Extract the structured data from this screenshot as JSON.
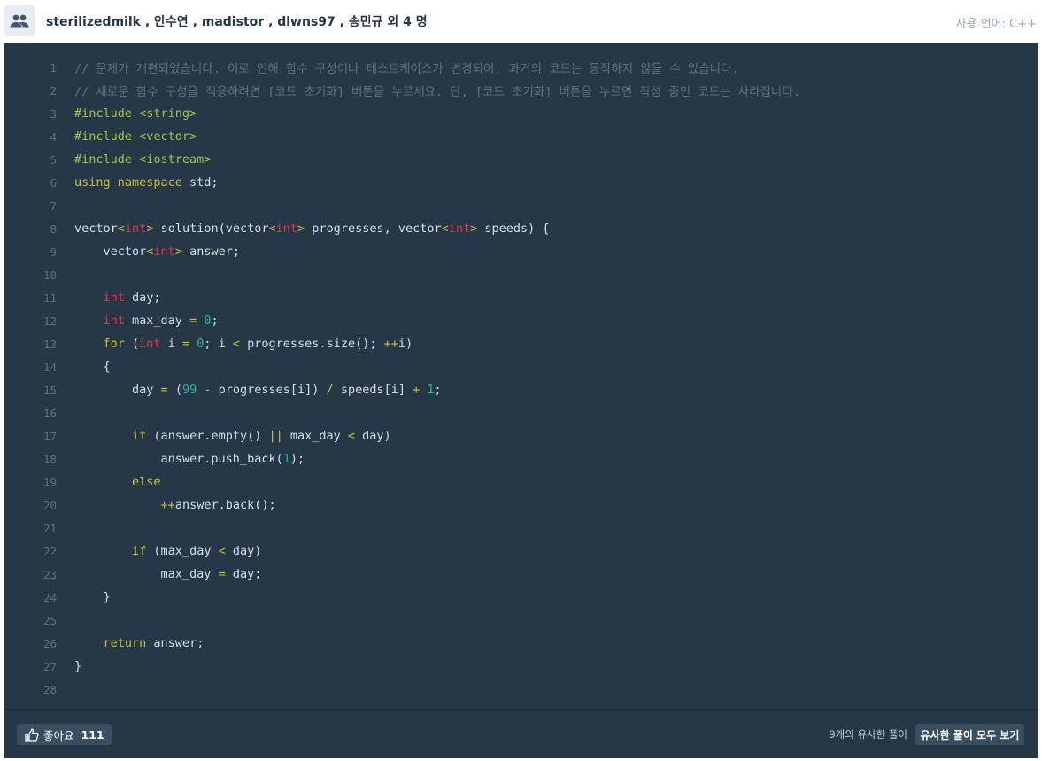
{
  "header": {
    "authors": "sterilizedmilk , 안수연 , madistor , dlwns97 , 송민규 외 4 명",
    "language": "사용 언어: C++",
    "icon": "people-icon"
  },
  "code": {
    "lines": [
      [
        [
          "c-comment",
          "// 문제가 개편되었습니다. 이로 인해 함수 구성이나 테스트케이스가 변경되어, 과거의 코드는 동작하지 않을 수 있습니다."
        ]
      ],
      [
        [
          "c-comment",
          "// 새로운 함수 구성을 적용하려면 [코드 초기화] 버튼을 누르세요. 단, [코드 초기화] 버튼을 누르면 작성 중인 코드는 사라집니다."
        ]
      ],
      [
        [
          "c-pre",
          "#include <string>"
        ]
      ],
      [
        [
          "c-pre",
          "#include <vector>"
        ]
      ],
      [
        [
          "c-pre",
          "#include <iostream>"
        ]
      ],
      [
        [
          "c-kw",
          "using namespace"
        ],
        [
          "c-plain",
          " std;"
        ]
      ],
      [],
      [
        [
          "c-plain",
          "vector"
        ],
        [
          "c-op",
          "<"
        ],
        [
          "c-type",
          "int"
        ],
        [
          "c-op",
          ">"
        ],
        [
          "c-plain",
          " solution(vector"
        ],
        [
          "c-op",
          "<"
        ],
        [
          "c-type",
          "int"
        ],
        [
          "c-op",
          ">"
        ],
        [
          "c-plain",
          " progresses, vector"
        ],
        [
          "c-op",
          "<"
        ],
        [
          "c-type",
          "int"
        ],
        [
          "c-op",
          ">"
        ],
        [
          "c-plain",
          " speeds) {"
        ]
      ],
      [
        [
          "c-plain",
          "    vector"
        ],
        [
          "c-op",
          "<"
        ],
        [
          "c-type",
          "int"
        ],
        [
          "c-op",
          ">"
        ],
        [
          "c-plain",
          " answer;"
        ]
      ],
      [],
      [
        [
          "c-plain",
          "    "
        ],
        [
          "c-type",
          "int"
        ],
        [
          "c-plain",
          " day;"
        ]
      ],
      [
        [
          "c-plain",
          "    "
        ],
        [
          "c-type",
          "int"
        ],
        [
          "c-plain",
          " max_day "
        ],
        [
          "c-op",
          "="
        ],
        [
          "c-plain",
          " "
        ],
        [
          "c-num",
          "0"
        ],
        [
          "c-plain",
          ";"
        ]
      ],
      [
        [
          "c-plain",
          "    "
        ],
        [
          "c-kw",
          "for"
        ],
        [
          "c-plain",
          " ("
        ],
        [
          "c-type",
          "int"
        ],
        [
          "c-plain",
          " i "
        ],
        [
          "c-op",
          "="
        ],
        [
          "c-plain",
          " "
        ],
        [
          "c-num",
          "0"
        ],
        [
          "c-plain",
          "; i "
        ],
        [
          "c-op",
          "<"
        ],
        [
          "c-plain",
          " progresses.size(); "
        ],
        [
          "c-op",
          "++"
        ],
        [
          "c-plain",
          "i)"
        ]
      ],
      [
        [
          "c-plain",
          "    {"
        ]
      ],
      [
        [
          "c-plain",
          "        day "
        ],
        [
          "c-op",
          "="
        ],
        [
          "c-plain",
          " ("
        ],
        [
          "c-num",
          "99"
        ],
        [
          "c-plain",
          " "
        ],
        [
          "c-op",
          "-"
        ],
        [
          "c-plain",
          " progresses[i]) "
        ],
        [
          "c-op",
          "/"
        ],
        [
          "c-plain",
          " speeds[i] "
        ],
        [
          "c-op",
          "+"
        ],
        [
          "c-plain",
          " "
        ],
        [
          "c-num",
          "1"
        ],
        [
          "c-plain",
          ";"
        ]
      ],
      [],
      [
        [
          "c-plain",
          "        "
        ],
        [
          "c-kw",
          "if"
        ],
        [
          "c-plain",
          " (answer.empty() "
        ],
        [
          "c-op",
          "||"
        ],
        [
          "c-plain",
          " max_day "
        ],
        [
          "c-op",
          "<"
        ],
        [
          "c-plain",
          " day)"
        ]
      ],
      [
        [
          "c-plain",
          "            answer.push_back("
        ],
        [
          "c-num",
          "1"
        ],
        [
          "c-plain",
          ");"
        ]
      ],
      [
        [
          "c-plain",
          "        "
        ],
        [
          "c-kw",
          "else"
        ]
      ],
      [
        [
          "c-plain",
          "            "
        ],
        [
          "c-op",
          "++"
        ],
        [
          "c-plain",
          "answer.back();"
        ]
      ],
      [],
      [
        [
          "c-plain",
          "        "
        ],
        [
          "c-kw",
          "if"
        ],
        [
          "c-plain",
          " (max_day "
        ],
        [
          "c-op",
          "<"
        ],
        [
          "c-plain",
          " day)"
        ]
      ],
      [
        [
          "c-plain",
          "            max_day "
        ],
        [
          "c-op",
          "="
        ],
        [
          "c-plain",
          " day;"
        ]
      ],
      [
        [
          "c-plain",
          "    }"
        ]
      ],
      [],
      [
        [
          "c-plain",
          "    "
        ],
        [
          "c-kw",
          "return"
        ],
        [
          "c-plain",
          " answer;"
        ]
      ],
      [
        [
          "c-plain",
          "}"
        ]
      ],
      []
    ]
  },
  "footer": {
    "like_label": "좋아요",
    "like_count": "111",
    "like_icon": "thumbs-up-icon",
    "similar_count_text": "9개의 유사한 풀이",
    "similar_button": "유사한 풀이 모두 보기"
  }
}
